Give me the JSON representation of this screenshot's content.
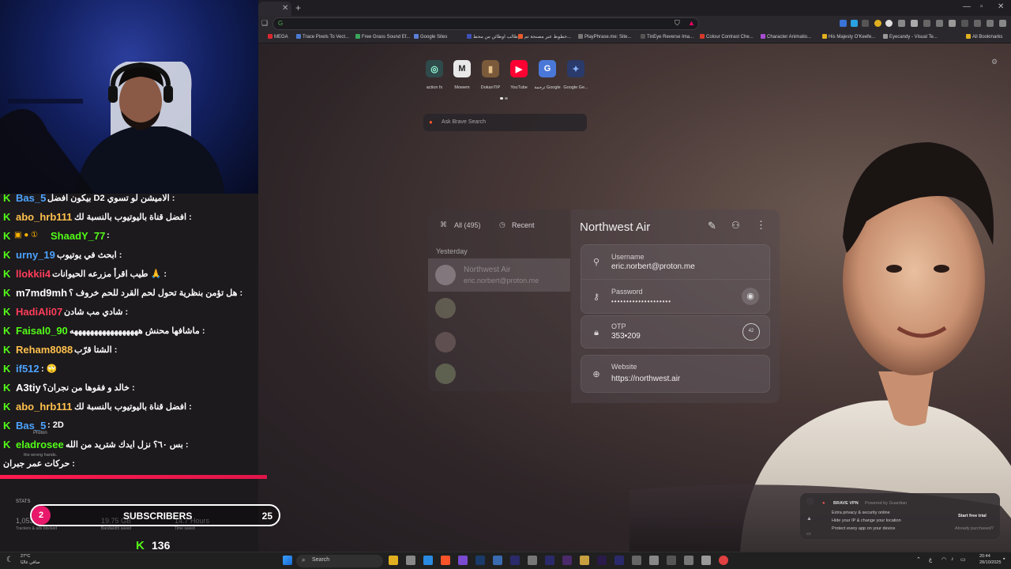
{
  "browser": {
    "tab_close": "✕",
    "new_tab": "+",
    "bookmarks": [
      {
        "label": "MEGA",
        "color": "#d9272e"
      },
      {
        "label": "Trace Pixels To Vect...",
        "color": "#4a7bd0"
      },
      {
        "label": "Free Grass Sound Ef...",
        "color": "#3aa65b"
      },
      {
        "label": "Google Sites",
        "color": "#5b7fd6"
      },
      {
        "label": "إطالب اوظائن س محط...",
        "color": "#3f51b5"
      },
      {
        "label": "خطوط عبر مصنحة تم...",
        "color": "#e85a2c"
      },
      {
        "label": "PlayPhrase.me: Site...",
        "color": "#777777"
      },
      {
        "label": "TinEye Reverse Ima...",
        "color": "#555555"
      },
      {
        "label": "Colour Contrast Che...",
        "color": "#d33a2c"
      },
      {
        "label": "Character Animatio...",
        "color": "#a94cd0"
      },
      {
        "label": "His Majesty O'Keefe...",
        "color": "#e0b020"
      },
      {
        "label": "Eyecandy - Visual Te...",
        "color": "#999999"
      },
      {
        "label": "All Bookmarks",
        "color": "#e0b020"
      }
    ],
    "shortcuts": [
      {
        "label": "action fx",
        "glyph": "◎",
        "bg": "#2f4a4a",
        "fg": "#9fd"
      },
      {
        "label": "Mowem",
        "glyph": "M",
        "bg": "#e8e8e8",
        "fg": "#222"
      },
      {
        "label": "DokanTIP",
        "glyph": "▮",
        "bg": "#7a5a3a",
        "fg": "#e6c08a"
      },
      {
        "label": "YouTube",
        "glyph": "▶",
        "bg": "#ff0033",
        "fg": "#fff"
      },
      {
        "label": "ترجمة Google",
        "glyph": "G",
        "bg": "#4a78d8",
        "fg": "#fff"
      },
      {
        "label": "Google Ge...",
        "glyph": "✦",
        "bg": "#2a3a6a",
        "fg": "#8ab4ff"
      }
    ],
    "search_placeholder": "Ask Brave Search"
  },
  "pass": {
    "tabs": {
      "all": "All (495)",
      "recent": "Recent"
    },
    "section": "Yesterday",
    "list_item": {
      "title": "Northwest Air",
      "subtitle": "eric.norbert@proton.me"
    },
    "item_title": "Northwest Air",
    "username_label": "Username",
    "username_value": "eric.norbert@proton.me",
    "password_label": "Password",
    "password_value": "••••••••••••••••••••",
    "otp_label": "OTP",
    "otp_value": "353•209",
    "otp_timer": "42",
    "website_label": "Website",
    "website_value": "https://northwest.air"
  },
  "chat": {
    "messages": [
      {
        "user": "Bas_5",
        "color": "#4da3ff",
        "text": "بيكون افضل Dالاميشن لو تسوي 2 :"
      },
      {
        "user": "abo_hrb111",
        "color": "#ffc04d",
        "text": "افضل قناة باليوتيوب بالنسبة لك :"
      },
      {
        "user": "ShaadY_77",
        "color": "#53fc18",
        "text": ":"
      },
      {
        "user": "urny_19",
        "color": "#4da3ff",
        "text": "ابحث في يوتيوب :"
      },
      {
        "user": "llokkii4",
        "color": "#ff3d5a",
        "text": "طيب اقرأ مزرعه الحيوانات 🙏 :"
      },
      {
        "user": "m7md9mh",
        "color": "#ffffff",
        "text": "هل تؤمن بنظرية تحول لحم القرد للحم خروف ؟ :"
      },
      {
        "user": "HadiAli07",
        "color": "#ff3d5a",
        "text": "شادي مب شادن :"
      },
      {
        "user": "Faisal0_90",
        "color": "#53fc18",
        "text": "ماشافها محنش هههههههههههههههههه :"
      },
      {
        "user": "Reham8088",
        "color": "#ffc04d",
        "text": "الشتا قرّب :"
      },
      {
        "user": "if512",
        "color": "#4da3ff",
        "text": ": 🙄"
      },
      {
        "user": "A3tiy",
        "color": "#ffffff",
        "text": "خالد و فقوها من نجران؟ :"
      },
      {
        "user": "abo_hrb111",
        "color": "#ffc04d",
        "text": "افضل قناة باليوتيوب بالنسبة لك :"
      },
      {
        "user": "Bas_5",
        "color": "#4da3ff",
        "text": ": 2D"
      },
      {
        "user": "eladrosee",
        "color": "#53fc18",
        "text": "بس ٦٠؟ نزل ايدك شتريد من الله :"
      },
      {
        "user": "",
        "color": "#ffffff",
        "text": "حركات عمر جبران :"
      }
    ]
  },
  "overlay": {
    "stats_label": "STATS",
    "subs_current": "2",
    "subs_label": "SUBSCRIBERS",
    "subs_goal": "25",
    "subs_progress": 0.08,
    "stat1_num": "1,053,414",
    "stat1_cap": "Trackers & ads blocked",
    "stat2_num": "19.75 GB",
    "stat2_cap": "Bandwidth saved",
    "stat3_num": "14.7 Hours",
    "stat3_cap": "Time saved",
    "kick_followers": "136",
    "proton_tag": "Proton",
    "proton_sub": "the wrong hands."
  },
  "vpn": {
    "title": "BRAVE VPN",
    "powered": "Powered by Guardian",
    "line1": "Extra privacy & security online",
    "line2": "Hide your IP & change your location",
    "line3": "Protect every app on your device",
    "cta": "Start free trial",
    "already": "Already purchased?"
  },
  "taskbar": {
    "weather_temp": "27°C",
    "weather_desc": "صافي غالبًا",
    "search": "Search",
    "time": "20:44",
    "date": "28/10/2025",
    "lang": "ع"
  }
}
